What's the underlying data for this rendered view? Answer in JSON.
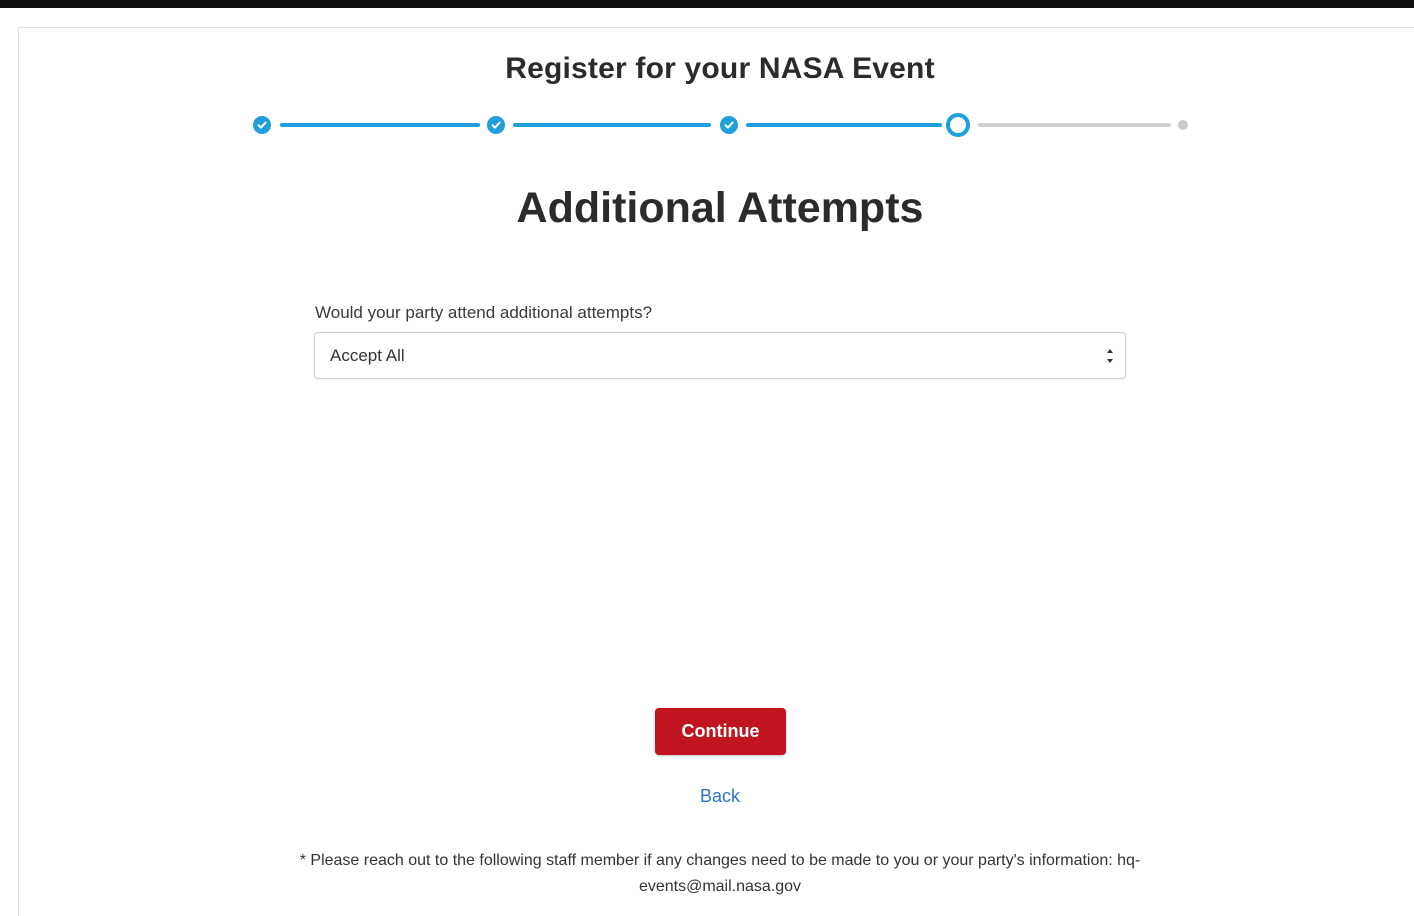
{
  "header": {
    "title": "Register for your NASA Event"
  },
  "stepper": {
    "steps": [
      {
        "state": "done",
        "icon": "checkmark-icon"
      },
      {
        "state": "done",
        "icon": "checkmark-icon"
      },
      {
        "state": "done",
        "icon": "checkmark-icon"
      },
      {
        "state": "current"
      },
      {
        "state": "upcoming"
      }
    ],
    "colors": {
      "active": "#1f9fdb",
      "inactive": "#cfcfcf"
    }
  },
  "main": {
    "section_title": "Additional Attempts",
    "question_label": "Would your party attend additional attempts?",
    "select": {
      "selected_value": "Accept All"
    },
    "continue_label": "Continue",
    "back_label": "Back",
    "footnote": "* Please reach out to the following staff member if any changes need to be made to you or your party's information:  hq-events@mail.nasa.gov"
  },
  "colors": {
    "primary_button": "#c0141f",
    "link": "#2e73c6"
  }
}
